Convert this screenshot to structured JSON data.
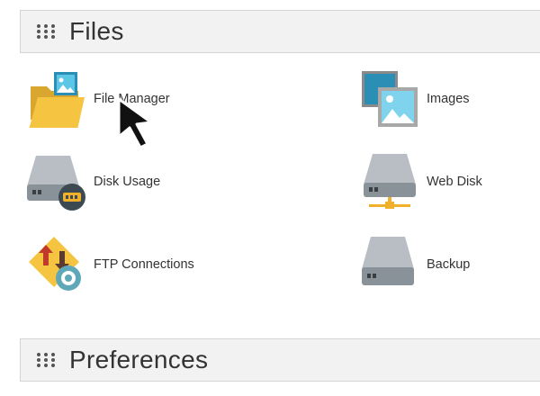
{
  "sections": {
    "files": {
      "title": "Files",
      "items": [
        {
          "label": "File Manager",
          "icon": "folder-image-icon"
        },
        {
          "label": "Images",
          "icon": "images-icon"
        },
        {
          "label": "Disk Usage",
          "icon": "disk-usage-icon"
        },
        {
          "label": "Web Disk",
          "icon": "web-disk-icon"
        },
        {
          "label": "FTP Connections",
          "icon": "ftp-icon"
        },
        {
          "label": "Backup",
          "icon": "backup-icon"
        }
      ]
    },
    "preferences": {
      "title": "Preferences"
    }
  },
  "cursor": {
    "icon": "mouse-pointer-icon"
  },
  "colors": {
    "header_bg": "#f2f2f2",
    "header_border": "#d4d4d4",
    "folder": "#f5c542",
    "drive": "#8a9299",
    "image_blue": "#3fb5d9"
  }
}
